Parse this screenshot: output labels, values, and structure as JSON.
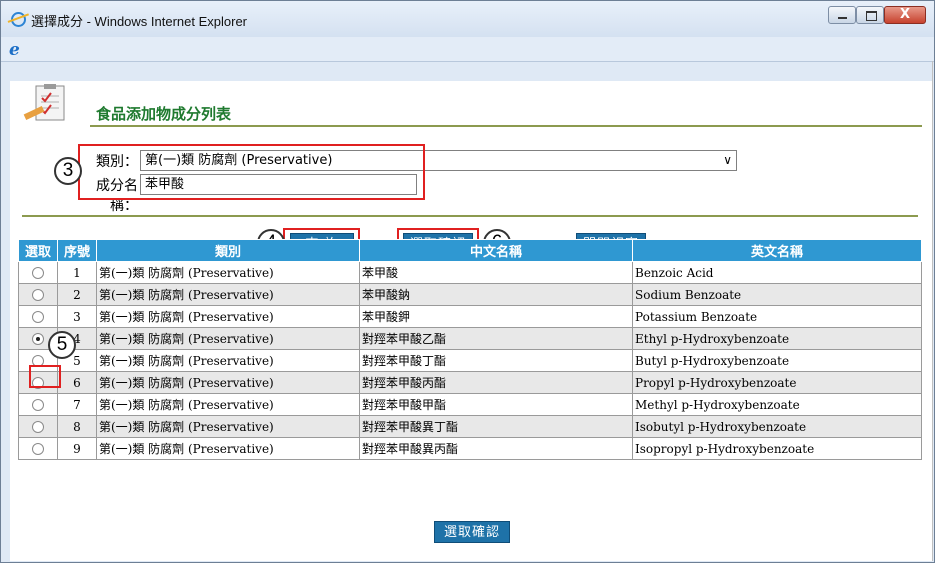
{
  "window": {
    "title": "選擇成分 - Windows Internet Explorer",
    "close_label": "X"
  },
  "page": {
    "title": "食品添加物成分列表"
  },
  "form": {
    "category_label": "類別：",
    "category_value": "第(一)類 防腐劑  (Preservative)",
    "ingredient_label": "成分名稱：",
    "ingredient_value": "苯甲酸"
  },
  "buttons": {
    "query": "查 詢",
    "confirm_top": "選取確認",
    "close_window": "關閉視窗",
    "confirm_bottom": "選取確認"
  },
  "callouts": [
    "3",
    "4",
    "5",
    "6"
  ],
  "table": {
    "headers": [
      "選取",
      "序號",
      "類別",
      "中文名稱",
      "英文名稱"
    ],
    "rows": [
      {
        "seq": "1",
        "category": "第(一)類 防腐劑  (Preservative)",
        "zh": "苯甲酸",
        "en": "Benzoic Acid",
        "selected": false
      },
      {
        "seq": "2",
        "category": "第(一)類 防腐劑  (Preservative)",
        "zh": "苯甲酸鈉",
        "en": "Sodium Benzoate",
        "selected": false
      },
      {
        "seq": "3",
        "category": "第(一)類 防腐劑  (Preservative)",
        "zh": "苯甲酸鉀",
        "en": "Potassium Benzoate",
        "selected": false
      },
      {
        "seq": "4",
        "category": "第(一)類 防腐劑  (Preservative)",
        "zh": "對羥苯甲酸乙酯",
        "en": "Ethyl p-Hydroxybenzoate",
        "selected": true
      },
      {
        "seq": "5",
        "category": "第(一)類 防腐劑  (Preservative)",
        "zh": "對羥苯甲酸丁酯",
        "en": "Butyl p-Hydroxybenzoate",
        "selected": false
      },
      {
        "seq": "6",
        "category": "第(一)類 防腐劑  (Preservative)",
        "zh": "對羥苯甲酸丙酯",
        "en": "Propyl p-Hydroxybenzoate",
        "selected": false
      },
      {
        "seq": "7",
        "category": "第(一)類 防腐劑  (Preservative)",
        "zh": "對羥苯甲酸甲酯",
        "en": "Methyl p-Hydroxybenzoate",
        "selected": false
      },
      {
        "seq": "8",
        "category": "第(一)類 防腐劑  (Preservative)",
        "zh": "對羥苯甲酸異丁酯",
        "en": "Isobutyl p-Hydroxybenzoate",
        "selected": false
      },
      {
        "seq": "9",
        "category": "第(一)類 防腐劑  (Preservative)",
        "zh": "對羥苯甲酸異丙酯",
        "en": "Isopropyl p-Hydroxybenzoate",
        "selected": false
      }
    ]
  },
  "colors": {
    "header_blue": "#2f98d2",
    "button_blue": "#1e72a8",
    "title_green": "#1f7a2f",
    "callout_red": "#e02020"
  }
}
